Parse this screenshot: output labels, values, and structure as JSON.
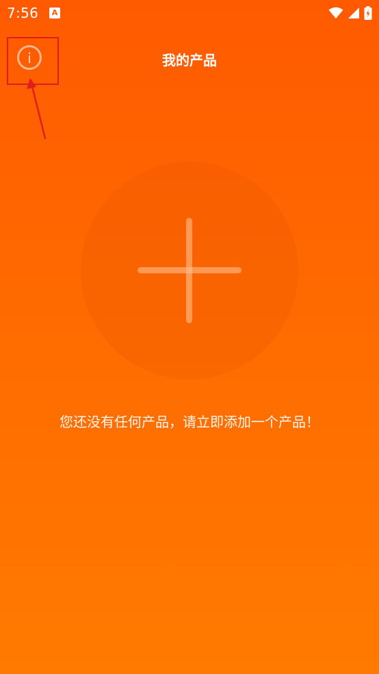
{
  "status_bar": {
    "time": "7:56",
    "app_icon_letter": "A",
    "icons": [
      "wifi-icon",
      "signal-icon",
      "battery-charging-icon"
    ]
  },
  "header": {
    "title": "我的产品",
    "info_icon": "i"
  },
  "empty_state": {
    "message": "您还没有任何产品，请立即添加一个产品！"
  },
  "colors": {
    "background_top": "#ff5a00",
    "background_bottom": "#ff7a00",
    "annotation": "#e21d1d"
  }
}
